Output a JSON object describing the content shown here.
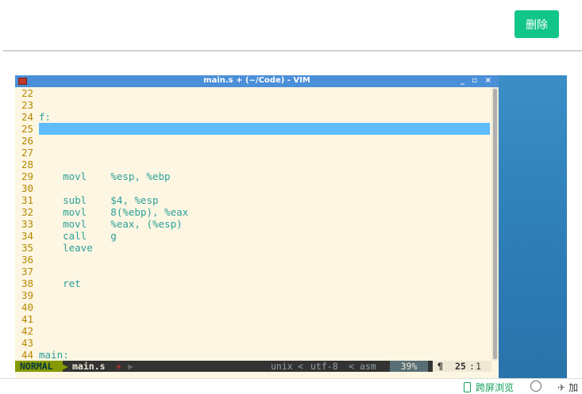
{
  "toolbar": {
    "delete_label": "删除"
  },
  "window": {
    "title": "main.s + (~/Code) - VIM",
    "controls": "_ ▫ ×"
  },
  "editor": {
    "lines": [
      {
        "num": "22",
        "code": ""
      },
      {
        "num": "23",
        "code": ""
      },
      {
        "num": "24",
        "code": "f:"
      },
      {
        "num": "25",
        "code": "",
        "current": true
      },
      {
        "num": "26",
        "code": ""
      },
      {
        "num": "27",
        "code": ""
      },
      {
        "num": "28",
        "code": ""
      },
      {
        "num": "29",
        "code": "    movl    %esp, %ebp"
      },
      {
        "num": "30",
        "code": ""
      },
      {
        "num": "31",
        "code": "    subl    $4, %esp"
      },
      {
        "num": "32",
        "code": "    movl    8(%ebp), %eax"
      },
      {
        "num": "33",
        "code": "    movl    %eax, (%esp)"
      },
      {
        "num": "34",
        "code": "    call    g"
      },
      {
        "num": "35",
        "code": "    leave"
      },
      {
        "num": "36",
        "code": ""
      },
      {
        "num": "37",
        "code": ""
      },
      {
        "num": "38",
        "code": "    ret"
      },
      {
        "num": "39",
        "code": ""
      },
      {
        "num": "40",
        "code": ""
      },
      {
        "num": "41",
        "code": ""
      },
      {
        "num": "42",
        "code": ""
      },
      {
        "num": "43",
        "code": ""
      },
      {
        "num": "44",
        "code": "main:"
      }
    ]
  },
  "statusline": {
    "mode": "NORMAL",
    "filename": "main.s",
    "modified": "+",
    "format": "unix",
    "encoding": "utf-8",
    "filetype": "asm",
    "percent": "39%",
    "line": "25",
    "col": "1"
  },
  "bottombar": {
    "cross_screen": "跨屏浏览",
    "extra": "加"
  },
  "colors": {
    "accent": "#12c58a",
    "highlight": "#5fbcff",
    "mode_bg": "#859900"
  }
}
